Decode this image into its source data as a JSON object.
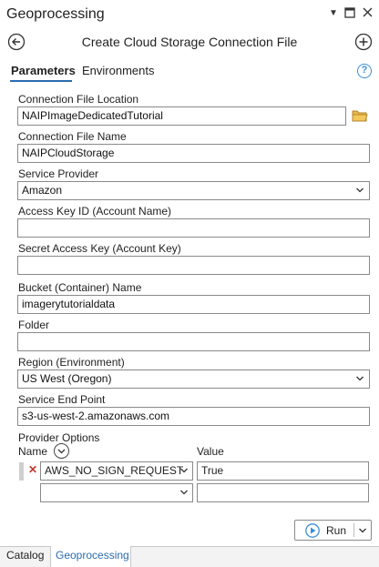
{
  "pane": {
    "title": "Geoprocessing",
    "tool_title": "Create Cloud Storage Connection File"
  },
  "tabs": [
    "Parameters",
    "Environments"
  ],
  "params": {
    "conn_loc": {
      "label": "Connection File Location",
      "value": "NAIPImageDedicatedTutorial"
    },
    "conn_name": {
      "label": "Connection File Name",
      "value": "NAIPCloudStorage"
    },
    "provider": {
      "label": "Service Provider",
      "value": "Amazon"
    },
    "access_key": {
      "label": "Access Key ID (Account Name)",
      "value": ""
    },
    "secret_key": {
      "label": "Secret Access Key (Account Key)",
      "value": ""
    },
    "bucket": {
      "label": "Bucket (Container) Name",
      "value": "imagerytutorialdata"
    },
    "folder": {
      "label": "Folder",
      "value": ""
    },
    "region": {
      "label": "Region (Environment)",
      "value": "US West (Oregon)"
    },
    "endpoint": {
      "label": "Service End Point",
      "value": "s3-us-west-2.amazonaws.com"
    }
  },
  "provider_options": {
    "label": "Provider Options",
    "name_header": "Name",
    "value_header": "Value",
    "rows": [
      {
        "name": "AWS_NO_SIGN_REQUEST",
        "value": "True"
      },
      {
        "name": "",
        "value": ""
      }
    ]
  },
  "run_label": "Run",
  "bottom_tabs": [
    "Catalog",
    "Geoprocessing"
  ],
  "icons": {
    "back": "back-arrow-icon",
    "add": "plus-circle-icon",
    "help": "help-icon",
    "folder": "folder-icon",
    "dropdown": "chevron-down-icon",
    "remove": "close-icon",
    "run": "play-icon"
  },
  "colors": {
    "accent": "#2b6cb0",
    "help": "#3a8fd8",
    "folder": "#d9a53a",
    "remove": "#c0392b"
  }
}
